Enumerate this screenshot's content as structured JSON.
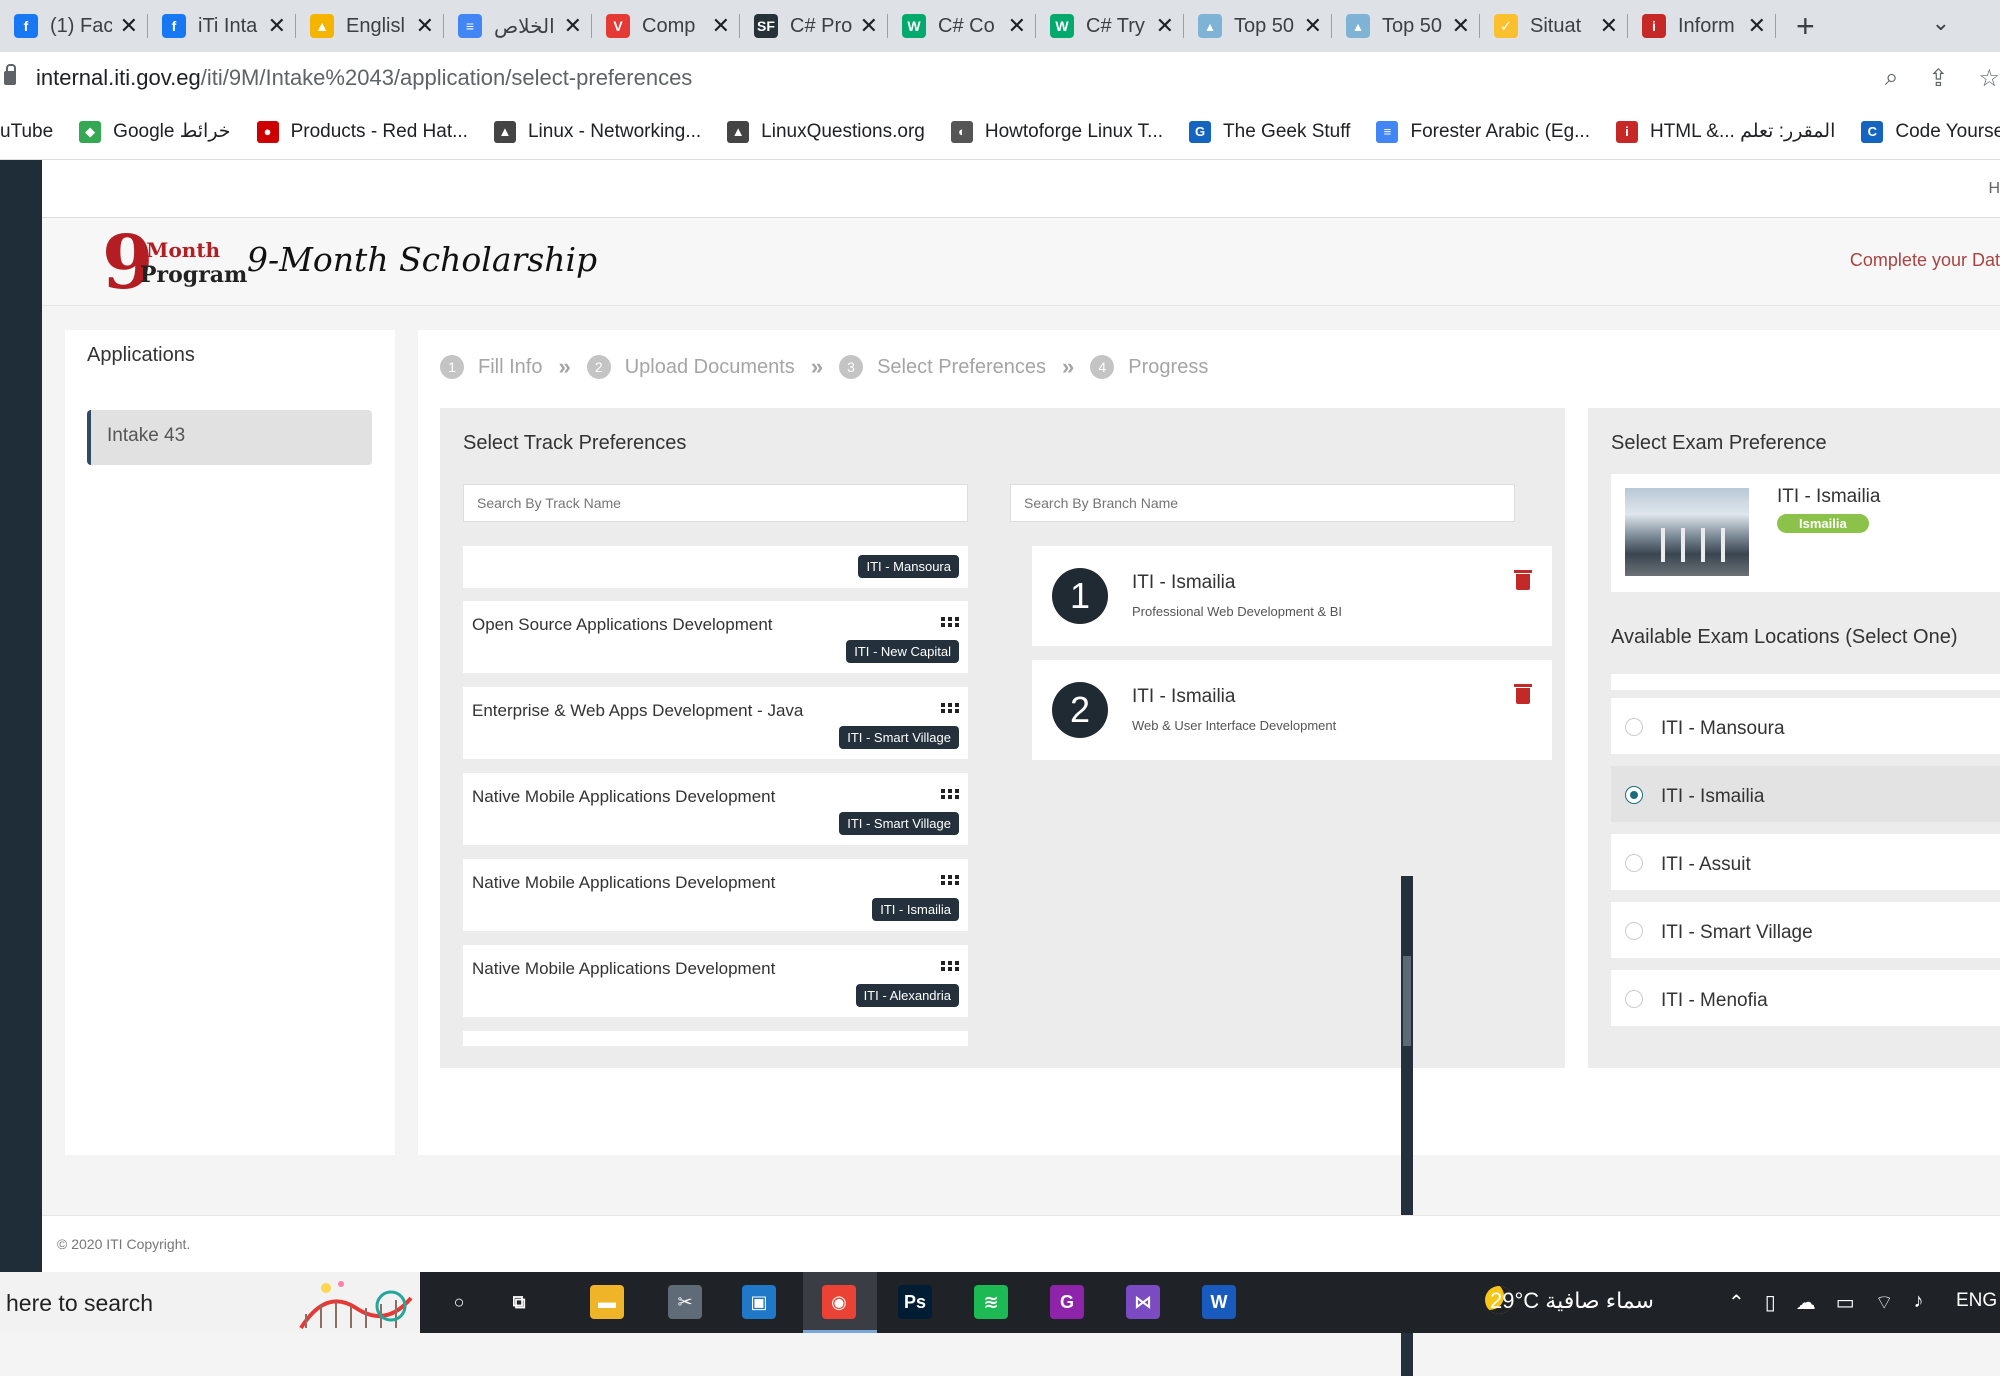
{
  "browser": {
    "tabs": [
      {
        "title": "(1) Fac",
        "icon": "facebook-icon",
        "color": "#1877f2",
        "glyph": "f"
      },
      {
        "title": "iTi Inta",
        "icon": "facebook-icon",
        "color": "#1877f2",
        "glyph": "f"
      },
      {
        "title": "Englisl",
        "icon": "google-drive-icon",
        "color": "#f4b400",
        "glyph": "▲"
      },
      {
        "title": "الخلاص",
        "icon": "google-docs-icon",
        "color": "#4285f4",
        "glyph": "≡"
      },
      {
        "title": "Comp",
        "icon": "tricentis-icon",
        "color": "#e53935",
        "glyph": "V"
      },
      {
        "title": "C# Pro",
        "icon": "csharp-site-icon",
        "color": "#263238",
        "glyph": "SF"
      },
      {
        "title": "C# Co",
        "icon": "w3schools-icon",
        "color": "#04aa6d",
        "glyph": "W"
      },
      {
        "title": "C# Try",
        "icon": "w3schools-icon",
        "color": "#04aa6d",
        "glyph": "W"
      },
      {
        "title": "Top 50",
        "icon": "chart-site-icon",
        "color": "#7fb3d5",
        "glyph": "▴"
      },
      {
        "title": "Top 50",
        "icon": "chart-site-icon",
        "color": "#7fb3d5",
        "glyph": "▴"
      },
      {
        "title": "Situat",
        "icon": "checkbox-site-icon",
        "color": "#fbc02d",
        "glyph": "✓"
      },
      {
        "title": "Inform",
        "icon": "iti-icon",
        "color": "#c62828",
        "glyph": "i"
      }
    ],
    "url_host": "internal.iti.gov.eg",
    "url_path": "/iti/9M/Intake%2043/application/select-preferences",
    "bookmarks": [
      {
        "label": "uTube",
        "color": "",
        "glyph": ""
      },
      {
        "label": "Google خرائط",
        "color": "#34a853",
        "glyph": "◆"
      },
      {
        "label": "Products - Red Hat...",
        "color": "#cc0000",
        "glyph": "●"
      },
      {
        "label": "Linux - Networking...",
        "color": "#444",
        "glyph": "▲"
      },
      {
        "label": "LinuxQuestions.org",
        "color": "#444",
        "glyph": "▲"
      },
      {
        "label": "Howtoforge Linux T...",
        "color": "#555",
        "glyph": "◐"
      },
      {
        "label": "The Geek Stuff",
        "color": "#1565c0",
        "glyph": "G"
      },
      {
        "label": "Forester Arabic (Eg...",
        "color": "#4285f4",
        "glyph": "≡"
      },
      {
        "label": "HTML &... المقرر: تعلم",
        "color": "#c62828",
        "glyph": "i"
      },
      {
        "label": "Code Yourself! An",
        "color": "#1565c0",
        "glyph": "C"
      }
    ]
  },
  "page": {
    "topbar_letter": "H",
    "logo": {
      "digit": "9",
      "month": "-Month",
      "program": "Program"
    },
    "site_title": "9-Month Scholarship",
    "complete_link": "Complete your Dat",
    "sidebar": {
      "title": "Applications",
      "items": [
        "Intake 43"
      ]
    },
    "steps": [
      {
        "num": "1",
        "label": "Fill Info"
      },
      {
        "num": "2",
        "label": "Upload Documents"
      },
      {
        "num": "3",
        "label": "Select Preferences"
      },
      {
        "num": "4",
        "label": "Progress"
      }
    ],
    "track_panel": {
      "title": "Select Track Preferences",
      "search_track_placeholder": "Search By Track Name",
      "search_branch_placeholder": "Search By Branch Name",
      "tracks": [
        {
          "name": "",
          "branch": "ITI - Mansoura"
        },
        {
          "name": "Open Source Applications Development",
          "branch": "ITI - New Capital"
        },
        {
          "name": "Enterprise & Web Apps Development - Java",
          "branch": "ITI - Smart Village"
        },
        {
          "name": "Native Mobile Applications Development",
          "branch": "ITI - Smart Village"
        },
        {
          "name": "Native Mobile Applications Development",
          "branch": "ITI - Ismailia"
        },
        {
          "name": "Native Mobile Applications Development",
          "branch": "ITI - Alexandria"
        }
      ],
      "preferences": [
        {
          "num": "1",
          "branch": "ITI - Ismailia",
          "track": "Professional Web Development & BI"
        },
        {
          "num": "2",
          "branch": "ITI - Ismailia",
          "track": "Web & User Interface Development"
        }
      ]
    },
    "exam_panel": {
      "title": "Select Exam Preference",
      "selected_name": "ITI - Ismailia",
      "selected_badge": "Ismailia",
      "available_title": "Available Exam Locations (Select One)",
      "locations": [
        {
          "label": "ITI - Mansoura",
          "selected": false
        },
        {
          "label": "ITI - Ismailia",
          "selected": true
        },
        {
          "label": "ITI - Assuit",
          "selected": false
        },
        {
          "label": "ITI - Smart Village",
          "selected": false
        },
        {
          "label": "ITI - Menofia",
          "selected": false
        }
      ]
    },
    "footer": "© 2020 ITI Copyright."
  },
  "taskbar": {
    "search_text": "here to search",
    "weather": "29°C سماء صافية",
    "language": "ENG",
    "apps": [
      {
        "name": "cortana-icon",
        "glyph": "○",
        "color": ""
      },
      {
        "name": "task-view-icon",
        "glyph": "⧉",
        "color": ""
      },
      {
        "name": "file-explorer-icon",
        "glyph": "▬",
        "color": "#f0b429"
      },
      {
        "name": "snipping-tool-icon",
        "glyph": "✂",
        "color": "#5f6b76"
      },
      {
        "name": "virtualbox-icon",
        "glyph": "▣",
        "color": "#1f78c8"
      },
      {
        "name": "chrome-icon",
        "glyph": "◉",
        "color": "#ea4335"
      },
      {
        "name": "photoshop-icon",
        "glyph": "Ps",
        "color": "#001d34"
      },
      {
        "name": "spotify-icon",
        "glyph": "≋",
        "color": "#1db954"
      },
      {
        "name": "pdf-app-icon",
        "glyph": "G",
        "color": "#8e24aa"
      },
      {
        "name": "visual-studio-icon",
        "glyph": "⋈",
        "color": "#7b4bc2"
      },
      {
        "name": "word-icon",
        "glyph": "W",
        "color": "#185abd"
      }
    ]
  }
}
